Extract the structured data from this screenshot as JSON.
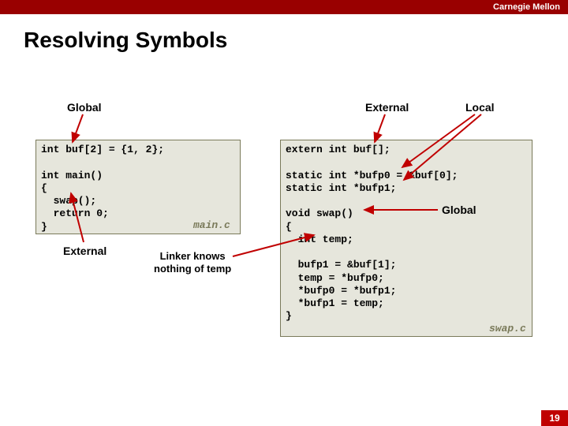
{
  "brand": "Carnegie Mellon",
  "title": "Resolving Symbols",
  "labels": {
    "global": "Global",
    "external": "External",
    "local": "Local",
    "linker_note_l1": "Linker knows",
    "linker_note_l2": "nothing of temp",
    "global_annot": "Global"
  },
  "code": {
    "main": "int buf[2] = {1, 2};\n\nint main()\n{\n  swap();\n  return 0;\n}",
    "main_file": "main.c",
    "swap": "extern int buf[];\n\nstatic int *bufp0 = &buf[0];\nstatic int *bufp1;\n\nvoid swap()\n{\n  int temp;\n\n  bufp1 = &buf[1];\n  temp = *bufp0;\n  *bufp0 = *bufp1;\n  *bufp1 = temp;\n}",
    "swap_file": "swap.c"
  },
  "page_number": "19"
}
